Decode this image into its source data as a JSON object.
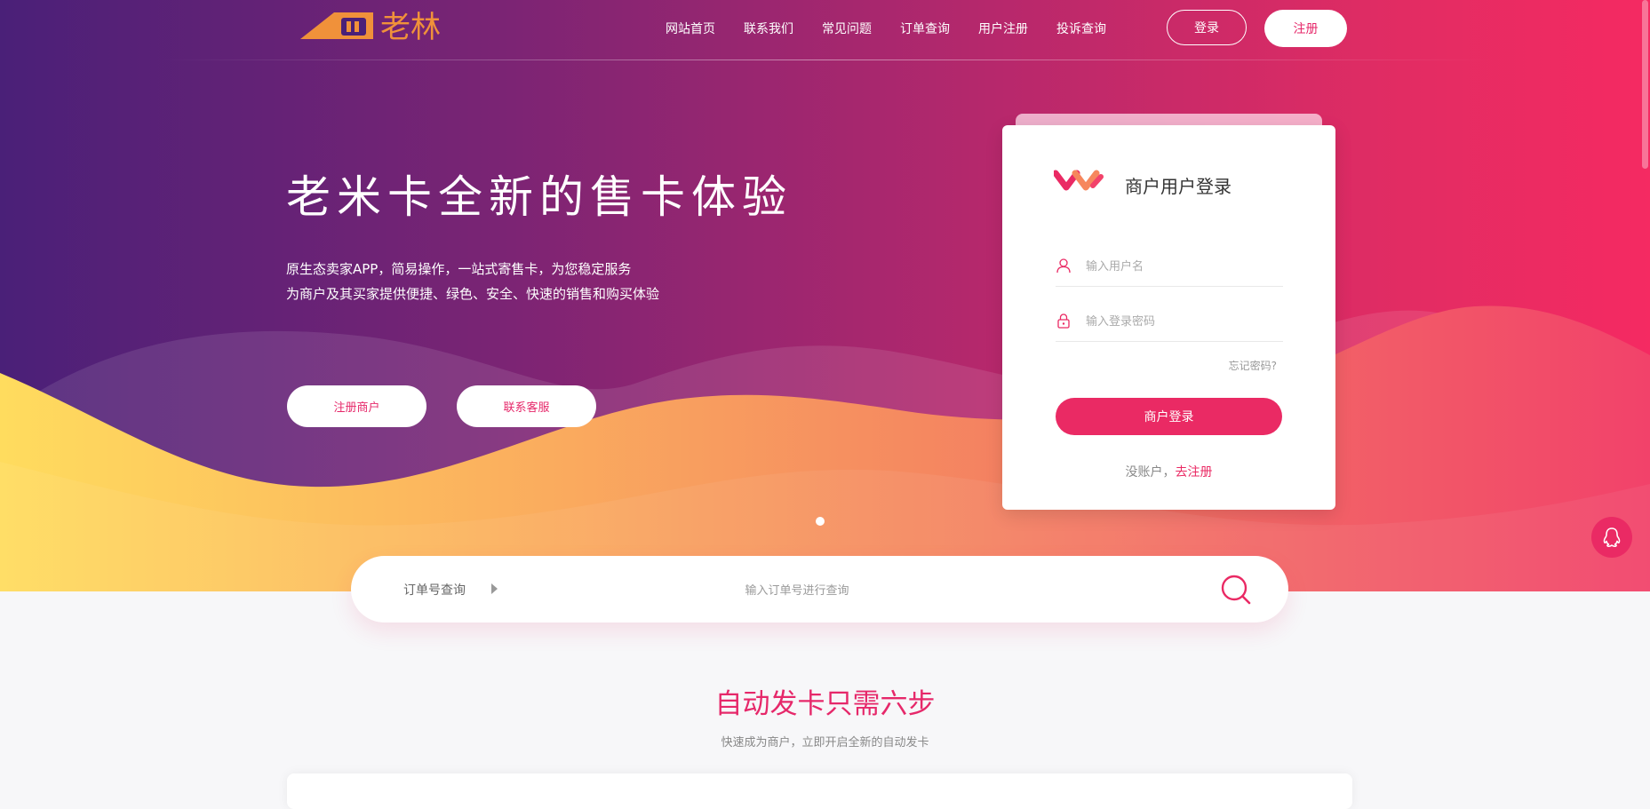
{
  "brand": {
    "logo_text": "老林",
    "logo_color": "#f0913a"
  },
  "nav": {
    "items": [
      "网站首页",
      "联系我们",
      "常见问题",
      "订单查询",
      "用户注册",
      "投诉查询"
    ]
  },
  "header_buttons": {
    "login": "登录",
    "register": "注册"
  },
  "hero": {
    "title": "老米卡全新的售卡体验",
    "subtitle_1": "原生态卖家APP，简易操作，一站式寄售卡，为您稳定服务",
    "subtitle_2": "为商户及其买家提供便捷、绿色、安全、快速的销售和购买体验",
    "btn_register_merchant": "注册商户",
    "btn_contact_service": "联系客服"
  },
  "login_card": {
    "title": "商户用户登录",
    "username_placeholder": "输入用户名",
    "password_placeholder": "输入登录密码",
    "forgot": "忘记密码?",
    "submit": "商户登录",
    "no_account": "没账户，",
    "register_link": "去注册"
  },
  "search": {
    "type_label": "订单号查询",
    "placeholder": "输入订单号进行查询",
    "icon": "search-icon"
  },
  "section": {
    "title": "自动发卡只需六步",
    "subtitle": "快速成为商户，立即开启全新的自动发卡"
  },
  "colors": {
    "accent": "#ea2a64",
    "hero_gradient_start": "#4a2078",
    "hero_gradient_end": "#f52a62",
    "wave_yellow": "#ffd85c",
    "wave_orange": "#f6875d"
  }
}
